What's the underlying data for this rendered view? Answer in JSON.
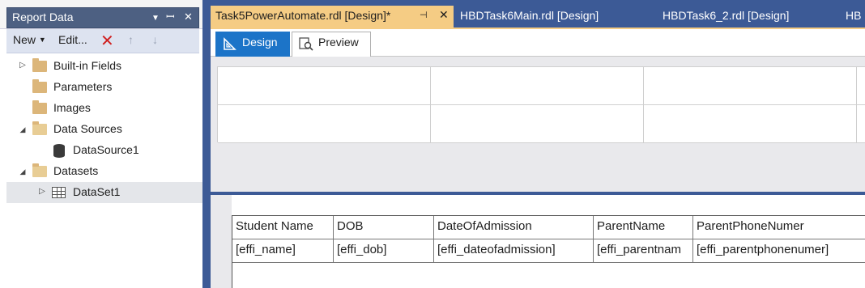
{
  "report_data_panel": {
    "title": "Report Data",
    "toolbar": {
      "new_label": "New",
      "edit_label": "Edit...",
      "delete_icon": "red-x-icon",
      "up_icon": "arrow-up-icon",
      "down_icon": "arrow-down-icon"
    },
    "tree": [
      {
        "label": "Built-in Fields",
        "icon": "folder-icon",
        "expander": "collapsed"
      },
      {
        "label": "Parameters",
        "icon": "folder-icon",
        "expander": "none"
      },
      {
        "label": "Images",
        "icon": "folder-icon",
        "expander": "none"
      },
      {
        "label": "Data Sources",
        "icon": "open-folder-icon",
        "expander": "expanded"
      },
      {
        "label": "DataSource1",
        "icon": "database-icon",
        "expander": "none"
      },
      {
        "label": "Datasets",
        "icon": "open-folder-icon",
        "expander": "expanded"
      },
      {
        "label": "DataSet1",
        "icon": "table-icon",
        "expander": "collapsed",
        "selected": true
      }
    ]
  },
  "document_tabs": [
    {
      "label": "Task5PowerAutomate.rdl [Design]*",
      "active": true
    },
    {
      "label": "HBDTask6Main.rdl [Design]",
      "active": false
    },
    {
      "label": "HBDTask6_2.rdl [Design]",
      "active": false
    },
    {
      "label": "HB",
      "active": false
    }
  ],
  "view_tabs": {
    "design": "Design",
    "preview": "Preview"
  },
  "tablix": {
    "headers": [
      "Student Name",
      "DOB",
      "DateOfAdmission",
      "ParentName",
      "ParentPhoneNumer"
    ],
    "fields": [
      "[effi_name]",
      "[effi_dob]",
      "[effi_dateofadmission]",
      "[effi_parentnam",
      "[effi_parentphonenumer]"
    ]
  },
  "colors": {
    "accent": "#3c5a96",
    "active_tab": "#f5cc84",
    "design_tab": "#1c74c8",
    "delete": "#d02020"
  }
}
